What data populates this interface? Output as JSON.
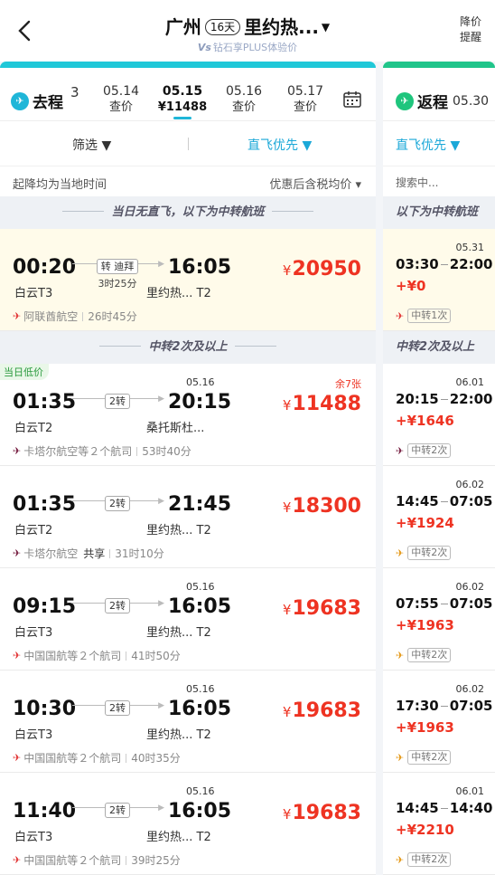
{
  "header": {
    "origin": "广州",
    "days": "16天",
    "destination": "里约热...",
    "plus_text": "钻石享PLUS体验价",
    "plus_prefix": "Vs",
    "alert_label": "降价提醒"
  },
  "outbound": {
    "label": "去程",
    "dates": [
      {
        "d": "3",
        "p": ""
      },
      {
        "d": "05.14",
        "p": "查价"
      },
      {
        "d": "05.15",
        "p": "¥11488",
        "selected": true
      },
      {
        "d": "05.16",
        "p": "查价"
      },
      {
        "d": "05.17",
        "p": "查价"
      }
    ],
    "filter_label": "筛选 ▼",
    "sort_label": "直飞优先 ▼",
    "info_left": "起降均为当地时间",
    "info_right": "优惠后含税均价 ▾",
    "section1": "当日无直飞，以下为中转航班",
    "section2": "中转2次及以上",
    "first_flight": {
      "dep_time": "00:20",
      "dep_airport": "白云T3",
      "transfer": "转 迪拜",
      "transfer_dur": "3时25分",
      "arr_time": "16:05",
      "arr_airport": "里约热... T2",
      "price": "20950",
      "airline": "阿联酋航空",
      "total": "26时45分"
    },
    "flights": [
      {
        "tag": "当日低价",
        "next": "05.16",
        "seats": "余7张",
        "dep_time": "01:35",
        "dep_airport": "白云T2",
        "stops": "2转",
        "arr_time": "20:15",
        "arr_airport": "桑托斯杜...",
        "price": "11488",
        "airline": "卡塔尔航空等２个航司",
        "share": "",
        "total": "53时40分"
      },
      {
        "tag": "",
        "next": "",
        "seats": "",
        "dep_time": "01:35",
        "dep_airport": "白云T2",
        "stops": "2转",
        "arr_time": "21:45",
        "arr_airport": "里约热... T2",
        "price": "18300",
        "airline": "卡塔尔航空",
        "share": "共享",
        "total": "31时10分"
      },
      {
        "tag": "",
        "next": "05.16",
        "seats": "",
        "dep_time": "09:15",
        "dep_airport": "白云T3",
        "stops": "2转",
        "arr_time": "16:05",
        "arr_airport": "里约热... T2",
        "price": "19683",
        "airline": "中国国航等２个航司",
        "share": "",
        "total": "41时50分"
      },
      {
        "tag": "",
        "next": "05.16",
        "seats": "",
        "dep_time": "10:30",
        "dep_airport": "白云T3",
        "stops": "2转",
        "arr_time": "16:05",
        "arr_airport": "里约热... T2",
        "price": "19683",
        "airline": "中国国航等２个航司",
        "share": "",
        "total": "40时35分"
      },
      {
        "tag": "",
        "next": "05.16",
        "seats": "",
        "dep_time": "11:40",
        "dep_airport": "白云T3",
        "stops": "2转",
        "arr_time": "16:05",
        "arr_airport": "里约热... T2",
        "price": "19683",
        "airline": "中国国航等２个航司",
        "share": "",
        "total": "39时25分"
      }
    ]
  },
  "inbound": {
    "label": "返程",
    "date": "05.30",
    "sort_label": "直飞优先 ▼",
    "info": "搜索中...",
    "section1": "以下为中转航班",
    "section2": "中转2次及以上",
    "first_flight": {
      "next": "05.31",
      "dep": "03:30",
      "arr": "22:00",
      "price": "+¥0",
      "tag": "中转1次"
    },
    "flights": [
      {
        "next": "06.01",
        "dep": "20:15",
        "arr": "22:00",
        "price": "+¥1646",
        "tag": "中转2次"
      },
      {
        "next": "06.02",
        "dep": "14:45",
        "arr": "07:05",
        "price": "+¥1924",
        "tag": "中转2次"
      },
      {
        "next": "06.02",
        "dep": "07:55",
        "arr": "07:05",
        "price": "+¥1963",
        "tag": "中转2次"
      },
      {
        "next": "06.02",
        "dep": "17:30",
        "arr": "07:05",
        "price": "+¥1963",
        "tag": "中转2次"
      },
      {
        "next": "06.01",
        "dep": "14:45",
        "arr": "14:40",
        "price": "+¥2210",
        "tag": "中转2次"
      }
    ]
  },
  "colors": {
    "accent": "#1fb6d8",
    "price": "#ee3322",
    "return_accent": "#20c58a"
  }
}
